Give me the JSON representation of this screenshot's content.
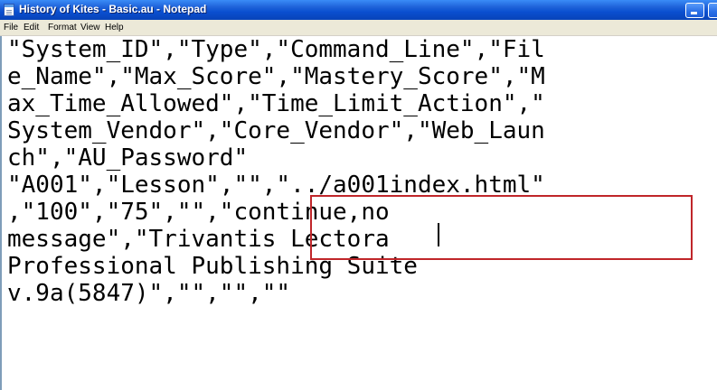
{
  "window": {
    "title": "History of Kites - Basic.au - Notepad"
  },
  "menu": {
    "items": [
      "File",
      "Edit",
      "Format",
      "View",
      "Help"
    ]
  },
  "editor": {
    "lines": [
      "\"System_ID\",\"Type\",\"Command_Line\",\"Fil",
      "e_Name\",\"Max_Score\",\"Mastery_Score\",\"M",
      "ax_Time_Allowed\",\"Time_Limit_Action\",\"",
      "System_Vendor\",\"Core_Vendor\",\"Web_Laun",
      "ch\",\"AU_Password\"",
      "\"A001\",\"Lesson\",\"\",\"../a001index.html\"",
      ",\"100\",\"75\",\"\",\"continue,no",
      "message\",\"Trivantis Lectora",
      "Professional Publishing Suite",
      "v.9a(5847)\",\"\",\"\",\"\""
    ]
  },
  "colors": {
    "highlight_box": "#c0262a",
    "titlebar": "#0a4fd0"
  }
}
